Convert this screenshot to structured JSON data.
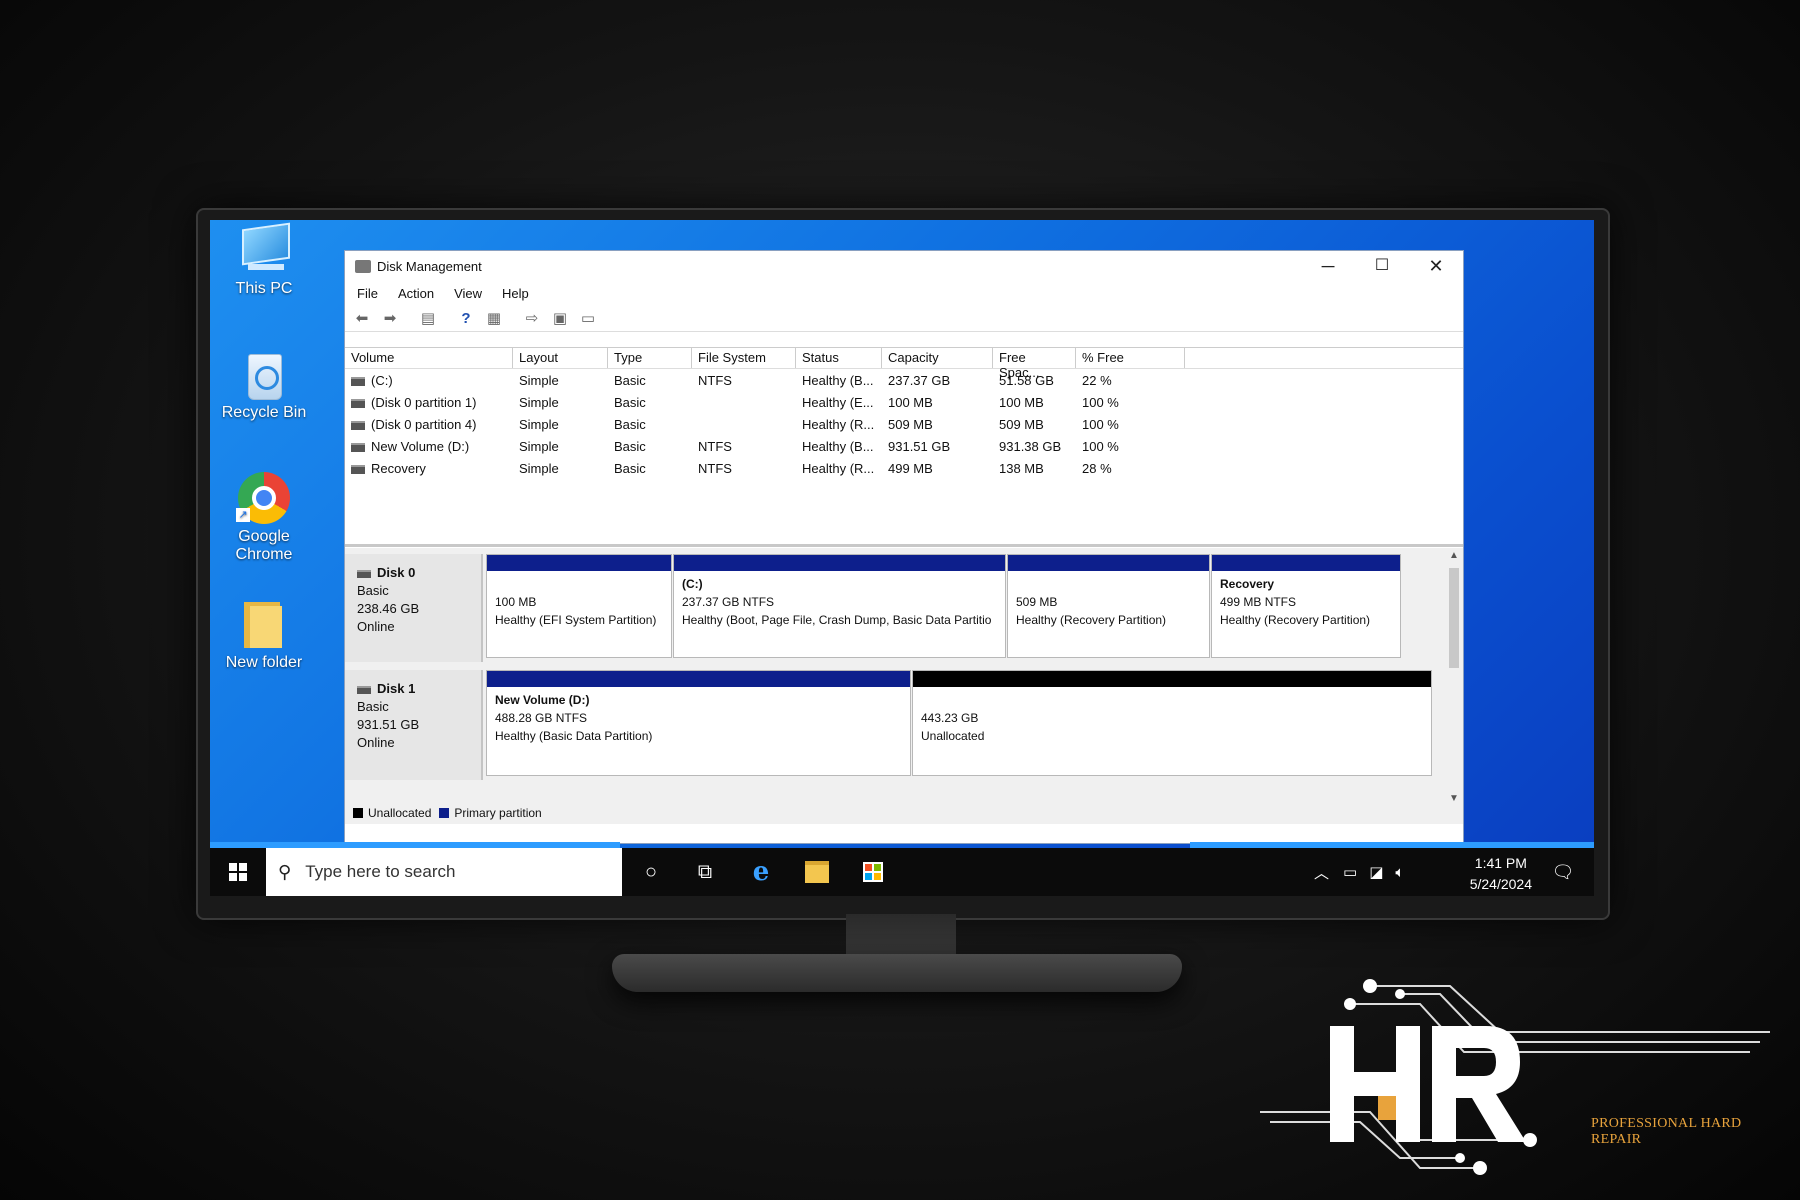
{
  "desktop": {
    "icons": [
      {
        "label": "This PC",
        "icon": "computer-icon"
      },
      {
        "label": "Recycle Bin",
        "icon": "recycle-bin-icon"
      },
      {
        "label": "Google Chrome",
        "icon": "chrome-icon"
      },
      {
        "label": "New folder",
        "icon": "folder-icon"
      }
    ]
  },
  "window": {
    "title": "Disk Management",
    "controls": {
      "minimize": "─",
      "maximize": "☐",
      "close": "✕"
    },
    "menu": [
      "File",
      "Action",
      "View",
      "Help"
    ]
  },
  "volume_table": {
    "headers": [
      "Volume",
      "Layout",
      "Type",
      "File System",
      "Status",
      "Capacity",
      "Free Spac...",
      "% Free"
    ],
    "rows": [
      [
        "(C:)",
        "Simple",
        "Basic",
        "NTFS",
        "Healthy (B...",
        "237.37 GB",
        "51.58 GB",
        "22 %"
      ],
      [
        "(Disk 0 partition 1)",
        "Simple",
        "Basic",
        "",
        "Healthy (E...",
        "100 MB",
        "100 MB",
        "100 %"
      ],
      [
        "(Disk 0 partition 4)",
        "Simple",
        "Basic",
        "",
        "Healthy (R...",
        "509 MB",
        "509 MB",
        "100 %"
      ],
      [
        "New Volume (D:)",
        "Simple",
        "Basic",
        "NTFS",
        "Healthy (B...",
        "931.51 GB",
        "931.38 GB",
        "100 %"
      ],
      [
        "Recovery",
        "Simple",
        "Basic",
        "NTFS",
        "Healthy (R...",
        "499 MB",
        "138 MB",
        "28 %"
      ]
    ]
  },
  "disks": [
    {
      "name": "Disk 0",
      "type": "Basic",
      "size": "238.46 GB",
      "state": "Online",
      "partitions": [
        {
          "name": "",
          "detail": "100 MB",
          "status": "Healthy (EFI System Partition)",
          "kind": "primary"
        },
        {
          "name": "(C:)",
          "detail": "237.37 GB NTFS",
          "status": "Healthy (Boot, Page File, Crash Dump, Basic Data Partitio",
          "kind": "primary"
        },
        {
          "name": "",
          "detail": "509 MB",
          "status": "Healthy (Recovery Partition)",
          "kind": "primary"
        },
        {
          "name": "Recovery",
          "detail": "499 MB NTFS",
          "status": "Healthy (Recovery Partition)",
          "kind": "primary"
        }
      ]
    },
    {
      "name": "Disk 1",
      "type": "Basic",
      "size": "931.51 GB",
      "state": "Online",
      "partitions": [
        {
          "name": "New Volume  (D:)",
          "detail": "488.28 GB NTFS",
          "status": "Healthy (Basic Data Partition)",
          "kind": "primary"
        },
        {
          "name": "",
          "detail": "443.23 GB",
          "status": "Unallocated",
          "kind": "unallocated"
        }
      ]
    }
  ],
  "legend": [
    {
      "label": "Unallocated",
      "color": "#000000"
    },
    {
      "label": "Primary partition",
      "color": "#0d1f8c"
    }
  ],
  "taskbar": {
    "search_placeholder": "Type here to search",
    "time": "1:41 PM",
    "date": "5/24/2024"
  },
  "brand": {
    "letters": "HR",
    "tagline": "PROFESSIONAL HARD REPAIR"
  },
  "colors": {
    "primary_partition": "#0d1f8c",
    "unallocated": "#000000",
    "desktop_blue": "#0f6fe0",
    "brand_orange": "#e8a33c"
  }
}
